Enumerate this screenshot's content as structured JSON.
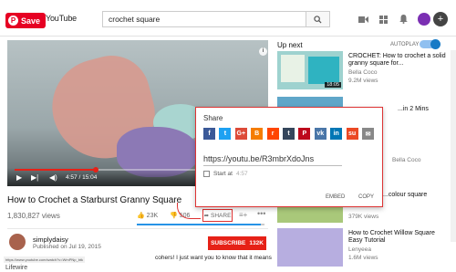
{
  "header": {
    "save_label": "Save",
    "logo_text": "YouTube",
    "search_value": "crochet square"
  },
  "player": {
    "current_time": "4:57",
    "duration": "15:04",
    "progress": 0.33
  },
  "video": {
    "title": "How to Crochet a Starburst Granny Square",
    "views": "1,830,827 views",
    "likes": "23K",
    "dislikes": "506",
    "share_label": "SHARE",
    "like_ratio": 0.97
  },
  "channel": {
    "name": "simplydaisy",
    "published": "Published on Jul 19, 2015",
    "subscribe_label": "SUBSCRIBE",
    "subscriber_count": "132K"
  },
  "comment_snippet": "cohers! I just want you to know that it means",
  "status_url": "https://www.youtube.com/watch?v=WmPNp_btk",
  "below_text": "Lifewire",
  "sidebar": {
    "up_next_label": "Up next",
    "autoplay_label": "AUTOPLAY",
    "items": [
      {
        "title": "CROCHET: How to crochet a solid granny square for...",
        "channel": "Bella Coco",
        "views": "9.2M views",
        "duration": "18:05"
      },
      {
        "title": "...in 2 Mins",
        "channel": "",
        "views": "",
        "duration": ""
      },
      {
        "title": "",
        "channel": "Bella Coco",
        "views": "",
        "duration": ""
      },
      {
        "title": "...colour square",
        "channel": "",
        "views": "379K views",
        "duration": ""
      },
      {
        "title": "How to Crochet Willow Square Easy Tutorial",
        "channel": "Lenyeea",
        "views": "1.6M views",
        "duration": ""
      }
    ]
  },
  "share_dialog": {
    "title": "Share",
    "url": "https://youtu.be/R3mbrXdoJns",
    "start_at_label": "Start at",
    "start_at_value": "4:57",
    "embed_label": "EMBED",
    "copy_label": "COPY",
    "networks": [
      "facebook",
      "twitter",
      "google-plus",
      "blogger",
      "reddit",
      "tumblr",
      "pinterest",
      "vk",
      "linkedin",
      "stumbleupon",
      "email"
    ],
    "colors": {
      "facebook": "#3b5998",
      "twitter": "#1da1f2",
      "google-plus": "#dd4b39",
      "blogger": "#f57d00",
      "reddit": "#ff4500",
      "tumblr": "#35465c",
      "pinterest": "#bd081c",
      "vk": "#4a76a8",
      "linkedin": "#0077b5",
      "stumbleupon": "#eb4924",
      "email": "#888888"
    }
  }
}
